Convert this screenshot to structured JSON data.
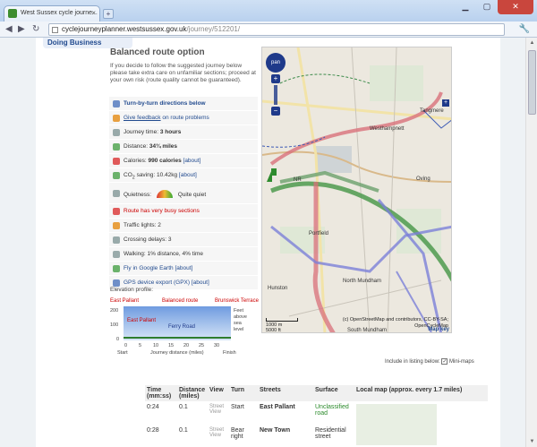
{
  "browser": {
    "tab_title": "West Sussex cycle journe...",
    "tab_close": "×",
    "new_tab": "+",
    "url_host": "cyclejourneyplanner.westsussex.gov.uk",
    "url_path": "/journey/512201/"
  },
  "nav": {
    "doing_business": "Doing Business"
  },
  "route": {
    "title": "Balanced route option",
    "intro": "If you decide to follow the suggested journey below please take extra care on unfamiliar sections; proceed at your own risk (route quality cannot be guaranteed)."
  },
  "info": {
    "turn_by_turn": "Turn-by-turn directions below",
    "feedback_link": "Give feedback",
    "feedback_rest": " on route problems",
    "journey_time_label": "Journey time: ",
    "journey_time": "3 hours",
    "distance_label": "Distance: ",
    "distance": "34¾ miles",
    "calories_label": "Calories: ",
    "calories": "990 calories",
    "about": "[about]",
    "co2_label": "CO",
    "co2_sub": "2",
    "co2_rest": " saving: 10.42kg",
    "quietness_label": "Quietness:",
    "quietness": "Quite quiet",
    "busy": "Route has very busy sections",
    "traffic_lights": "Traffic lights: 2",
    "crossing_delays": "Crossing delays: 3",
    "walking": "Walking: 1% distance, 4% time",
    "google_earth": "Fly in Google Earth",
    "gps": "GPS device export (GPX)"
  },
  "elevation": {
    "label": "Elevation profile:",
    "start_place": "East Pallant",
    "mid_place": "Balanced route",
    "end_place": "Brunswick Terrace",
    "inner_place": "East Pallant",
    "inner_road": "Ferry Road",
    "y_ticks": [
      "200",
      "100",
      "0"
    ],
    "y_unit": [
      "Feet",
      "above",
      "sea",
      "level"
    ],
    "x_ticks": [
      "0",
      "5",
      "10",
      "15",
      "20",
      "25",
      "30"
    ],
    "start": "Start",
    "axis": "Journey distance (miles)",
    "finish": "Finish"
  },
  "map": {
    "places": {
      "westhampnett": "Westhampnett",
      "tangmere": "Tangmere",
      "oving": "Oving",
      "north_mundham": "North Mundham",
      "south_mundham": "South Mundham",
      "hunston": "Hunston",
      "chichester": "NR",
      "portfield": "Portfield"
    },
    "pan": "pan",
    "zoom_in": "+",
    "zoom_out": "−",
    "side_plus": "+",
    "scale_m": "1000 m",
    "scale_ft": "5000 ft",
    "credit_1": "(c) OpenStreetMap and contributors, CC-BY-SA;",
    "credit_2": "OpenCycleMap",
    "key": "Map key"
  },
  "listing": {
    "label": "Include in listing below:",
    "checkbox": "✓",
    "option": "Mini-maps"
  },
  "table": {
    "headers": [
      "Time (mm:ss)",
      "Distance (miles)",
      "View",
      "Turn",
      "Streets",
      "Surface",
      "Local map (approx. every 1.7 miles)"
    ],
    "rows": [
      {
        "time": "0:24",
        "dist": "0.1",
        "view": "Street View",
        "turn": "Start",
        "street": "East Pallant",
        "surface": "Unclassified road"
      },
      {
        "time": "0:28",
        "dist": "0.1",
        "view": "Street View",
        "turn": "Bear right",
        "street": "New Town",
        "surface": "Residential street"
      }
    ]
  }
}
